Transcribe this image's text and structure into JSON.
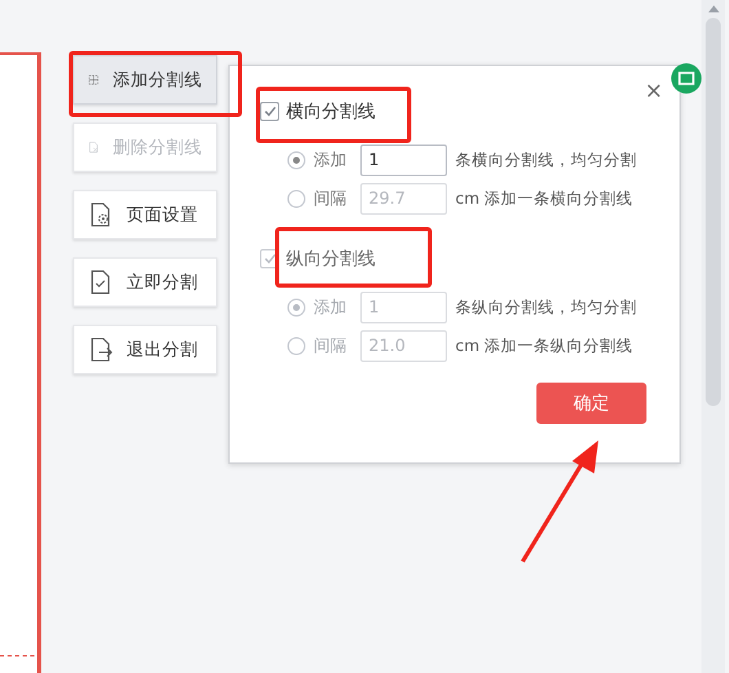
{
  "sidebar": {
    "items": [
      {
        "label": "添加分割线",
        "kind": "add",
        "selected": true,
        "disabled": false
      },
      {
        "label": "删除分割线",
        "kind": "delete",
        "selected": false,
        "disabled": true
      },
      {
        "label": "页面设置",
        "kind": "settings",
        "selected": false,
        "disabled": false
      },
      {
        "label": "立即分割",
        "kind": "apply",
        "selected": false,
        "disabled": false
      },
      {
        "label": "退出分割",
        "kind": "exit",
        "selected": false,
        "disabled": false
      }
    ]
  },
  "dialog": {
    "close": "×",
    "sections": [
      {
        "label": "横向分割线",
        "checked": true,
        "disabled": false,
        "options": [
          {
            "label": "添加",
            "selected": true,
            "value": "1",
            "disabled": false,
            "description": "条横向分割线，均匀分割"
          },
          {
            "label": "间隔",
            "selected": false,
            "value": "29.7",
            "disabled": true,
            "description": "cm 添加一条横向分割线"
          }
        ]
      },
      {
        "label": "纵向分割线",
        "checked": true,
        "disabled": true,
        "options": [
          {
            "label": "添加",
            "selected": true,
            "value": "1",
            "disabled": true,
            "description": "条纵向分割线，均匀分割"
          },
          {
            "label": "间隔",
            "selected": false,
            "value": "21.0",
            "disabled": true,
            "description": "cm 添加一条纵向分割线"
          }
        ]
      }
    ],
    "confirm": "确定"
  }
}
